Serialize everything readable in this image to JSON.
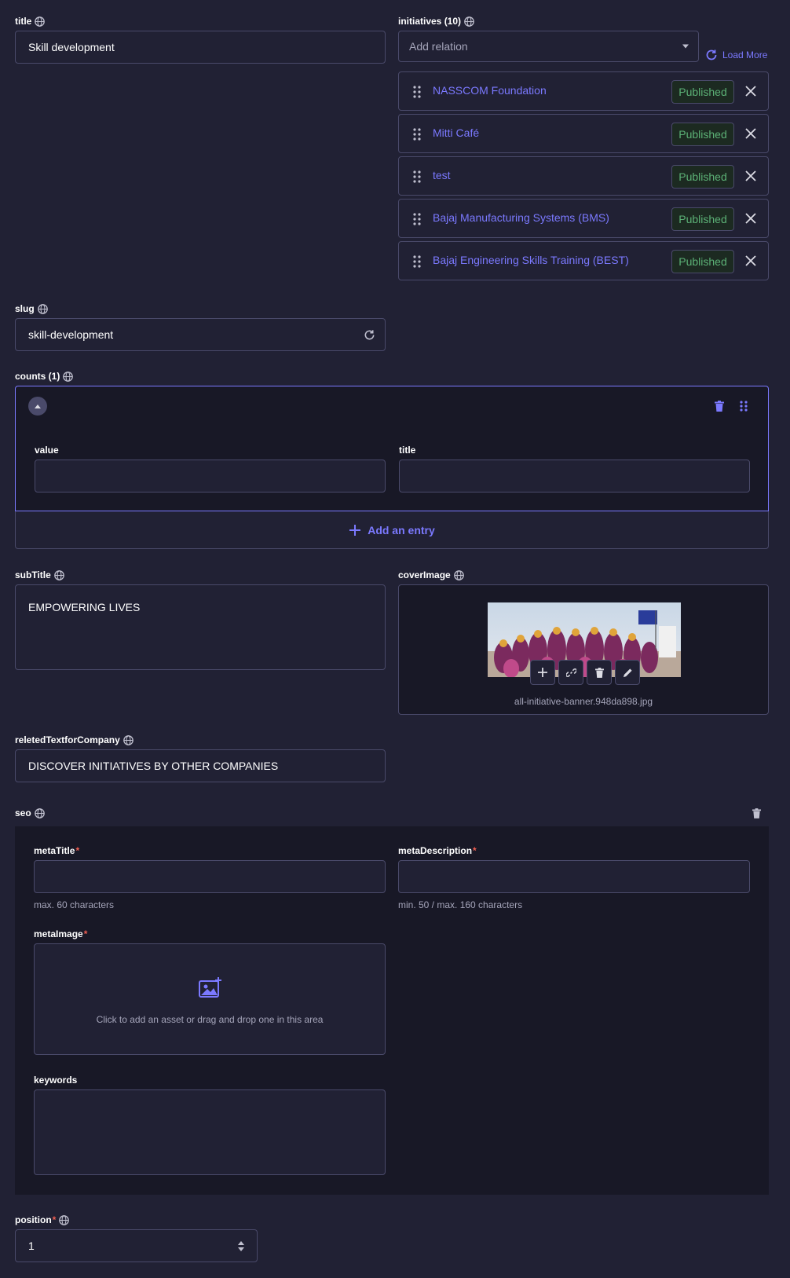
{
  "title_field": {
    "label": "title",
    "value": "Skill development"
  },
  "initiatives": {
    "label": "initiatives (10)",
    "placeholder": "Add relation",
    "load_more": "Load More",
    "items": [
      {
        "name": "NASSCOM Foundation",
        "status": "Published"
      },
      {
        "name": "Mitti Café",
        "status": "Published"
      },
      {
        "name": "test",
        "status": "Published"
      },
      {
        "name": "Bajaj Manufacturing Systems (BMS)",
        "status": "Published"
      },
      {
        "name": "Bajaj Engineering Skills Training (BEST)",
        "status": "Published"
      }
    ]
  },
  "slug": {
    "label": "slug",
    "value": "skill-development"
  },
  "counts": {
    "label": "counts (1)",
    "entry": {
      "value_label": "value",
      "value": "",
      "title_label": "title",
      "title": ""
    },
    "add_entry": "Add an entry"
  },
  "subtitle": {
    "label": "subTitle",
    "value": "EMPOWERING LIVES"
  },
  "cover_image": {
    "label": "coverImage",
    "filename": "all-initiative-banner.948da898.jpg"
  },
  "related_text": {
    "label": "reletedTextforCompany",
    "value": "DISCOVER INITIATIVES BY OTHER COMPANIES"
  },
  "seo": {
    "label": "seo",
    "meta_title": {
      "label": "metaTitle",
      "value": "",
      "help": "max. 60 characters"
    },
    "meta_description": {
      "label": "metaDescription",
      "value": "",
      "help": "min. 50 / max. 160 characters"
    },
    "meta_image": {
      "label": "metaImage",
      "hint": "Click to add an asset or drag and drop one in this area"
    },
    "keywords": {
      "label": "keywords",
      "value": ""
    }
  },
  "position": {
    "label": "position",
    "value": "1"
  },
  "colors": {
    "background": "#212134",
    "panel": "#181826",
    "accent": "#7b79ff",
    "success": "#5cb176",
    "border": "#4a4a6a",
    "required": "#ee5e52"
  }
}
